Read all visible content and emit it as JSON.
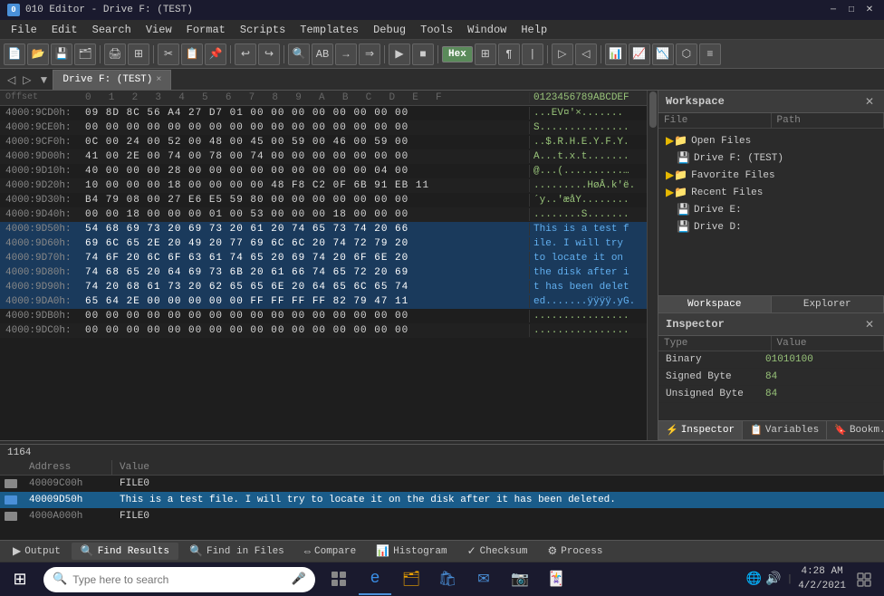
{
  "titlebar": {
    "title": "010 Editor - Drive F: (TEST)",
    "icon": "0",
    "minimize": "─",
    "maximize": "□",
    "close": "✕"
  },
  "menubar": {
    "items": [
      "File",
      "Edit",
      "Search",
      "View",
      "Format",
      "Scripts",
      "Templates",
      "Debug",
      "Tools",
      "Window",
      "Help"
    ]
  },
  "tab": {
    "label": "Drive F: (TEST)",
    "close": "×"
  },
  "workspace": {
    "title": "Workspace",
    "file_col": "File",
    "path_col": "Path",
    "tree": [
      {
        "label": "Open Files",
        "icon": "📁",
        "indent": 0
      },
      {
        "label": "Drive F: (TEST)",
        "icon": "💾",
        "indent": 1
      },
      {
        "label": "Favorite Files",
        "icon": "📁",
        "indent": 0
      },
      {
        "label": "Recent Files",
        "icon": "📁",
        "indent": 0
      },
      {
        "label": "Drive E:",
        "icon": "💾",
        "indent": 1
      },
      {
        "label": "Drive D:",
        "icon": "💾",
        "indent": 1
      }
    ],
    "tabs": [
      "Workspace",
      "Explorer"
    ]
  },
  "inspector": {
    "title": "Inspector",
    "type_col": "Type",
    "value_col": "Value",
    "rows": [
      {
        "type": "Binary",
        "value": "01010100"
      },
      {
        "type": "Signed Byte",
        "value": "84"
      },
      {
        "type": "Unsigned Byte",
        "value": "84"
      }
    ],
    "tabs": [
      "Inspector",
      "Variables",
      "Bookm..."
    ]
  },
  "hex_header": {
    "offset_label": "",
    "cols": [
      "0",
      "1",
      "2",
      "3",
      "4",
      "5",
      "6",
      "7",
      "8",
      "9",
      "A",
      "B",
      "C",
      "D",
      "E",
      "F"
    ],
    "ascii_label": "0123456789ABCDEF"
  },
  "hex_rows": [
    {
      "addr": "4000:9CD0h:",
      "bytes": "09 8D 8C 56 A4 27 D7 01 00 00 00 00 00 00 00 00",
      "ascii": "...EV¤'×.......",
      "highlight": false
    },
    {
      "addr": "4000:9CE0h:",
      "bytes": "00 00 00 00 00 00 00 00 00 00 00 00 00 00 00 00",
      "ascii": "S...............",
      "highlight": false
    },
    {
      "addr": "4000:9CF0h:",
      "bytes": "0C 00 24 00 52 00 48 00 45 00 59 00 46 00 59 00",
      "ascii": "..$.R.H.E.Y.F.Y.",
      "highlight": false
    },
    {
      "addr": "4000:9D00h:",
      "bytes": "41 00 2E 00 74 00 78 00 74 00 00 00 00 00 00 00",
      "ascii": "A...t.x.t.......",
      "highlight": false
    },
    {
      "addr": "4000:9D10h:",
      "bytes": "40 00 00 00 28 00 00 00 00 00 00 00 00 00 04 00",
      "ascii": "@...(..........…",
      "highlight": false
    },
    {
      "addr": "4000:9D20h:",
      "bytes": "10 00 00 00 18 00 00 00 00 48 F8 C2 0F 6B 91 EB 11",
      "ascii": ".........HøÂ.k'ë.",
      "highlight": false
    },
    {
      "addr": "4000:9D30h:",
      "bytes": "B4 79 08 00 27 E6 E5 59 80 00 00 00 00 00 00 00",
      "ascii": "´y..'æåY........",
      "highlight": false
    },
    {
      "addr": "4000:9D40h:",
      "bytes": "00 00 18 00 00 00 01 00 53 00 00 00 18 00 00 00",
      "ascii": "........S.......",
      "highlight": false
    },
    {
      "addr": "4000:9D50h:",
      "bytes": "54 68 69 73 20 69 73 20 61 20 74 65 73 74 20 66",
      "ascii": "This is a test f",
      "highlight": true
    },
    {
      "addr": "4000:9D60h:",
      "bytes": "69 6C 65 2E 20 49 20 77 69 6C 6C 20 74 72 79 20",
      "ascii": "ile. I will try ",
      "highlight": true
    },
    {
      "addr": "4000:9D70h:",
      "bytes": "74 6F 20 6C 6F 63 61 74 65 20 69 74 20 6F 6E 20",
      "ascii": "to locate it on ",
      "highlight": true
    },
    {
      "addr": "4000:9D80h:",
      "bytes": "74 68 65 20 64 69 73 6B 20 61 66 74 65 72 20 69",
      "ascii": "the disk after i",
      "highlight": true
    },
    {
      "addr": "4000:9D90h:",
      "bytes": "74 20 68 61 73 20 62 65 65 6E 20 64 65 6C 65 74",
      "ascii": "t has been delet",
      "highlight": true
    },
    {
      "addr": "4000:9DA0h:",
      "bytes": "65 64 2E 00 00 00 00 00 FF FF FF FF 82 79 47 11",
      "ascii": "ed.......ÿÿÿÿ.yG.",
      "highlight": true
    },
    {
      "addr": "4000:9DB0h:",
      "bytes": "00 00 00 00 00 00 00 00 00 00 00 00 00 00 00 00",
      "ascii": "................",
      "highlight": false
    },
    {
      "addr": "4000:9DC0h:",
      "bytes": "00 00 00 00 00 00 00 00 00 00 00 00 00 00 00 00",
      "ascii": "................",
      "highlight": false
    }
  ],
  "find_results": {
    "title": "Find Results",
    "addr_col": "Address",
    "val_col": "Value",
    "rows": [
      {
        "addr": "40009C00h",
        "value": "FILE0",
        "selected": false,
        "color": "#888"
      },
      {
        "addr": "40009D50h",
        "value": "This is a test file. I will try to locate it on the disk after it has been deleted.",
        "selected": true,
        "color": "#4a90d9"
      },
      {
        "addr": "4000A000h",
        "value": "FILE0",
        "selected": false,
        "color": "#888"
      }
    ],
    "count": "1164"
  },
  "bottom_tabs": [
    {
      "label": "Output",
      "icon": "▶",
      "active": false
    },
    {
      "label": "Find Results",
      "icon": "🔍",
      "active": true
    },
    {
      "label": "Find in Files",
      "icon": "🔍",
      "active": false
    },
    {
      "label": "Compare",
      "icon": "⇔",
      "active": false
    },
    {
      "label": "Histogram",
      "icon": "📊",
      "active": false
    },
    {
      "label": "Checksum",
      "icon": "✓",
      "active": false
    },
    {
      "label": "Process",
      "icon": "⚙",
      "active": false
    }
  ],
  "taskbar": {
    "search_placeholder": "Type here to search",
    "time": "4:28 AM",
    "date": "4/2/2021"
  }
}
